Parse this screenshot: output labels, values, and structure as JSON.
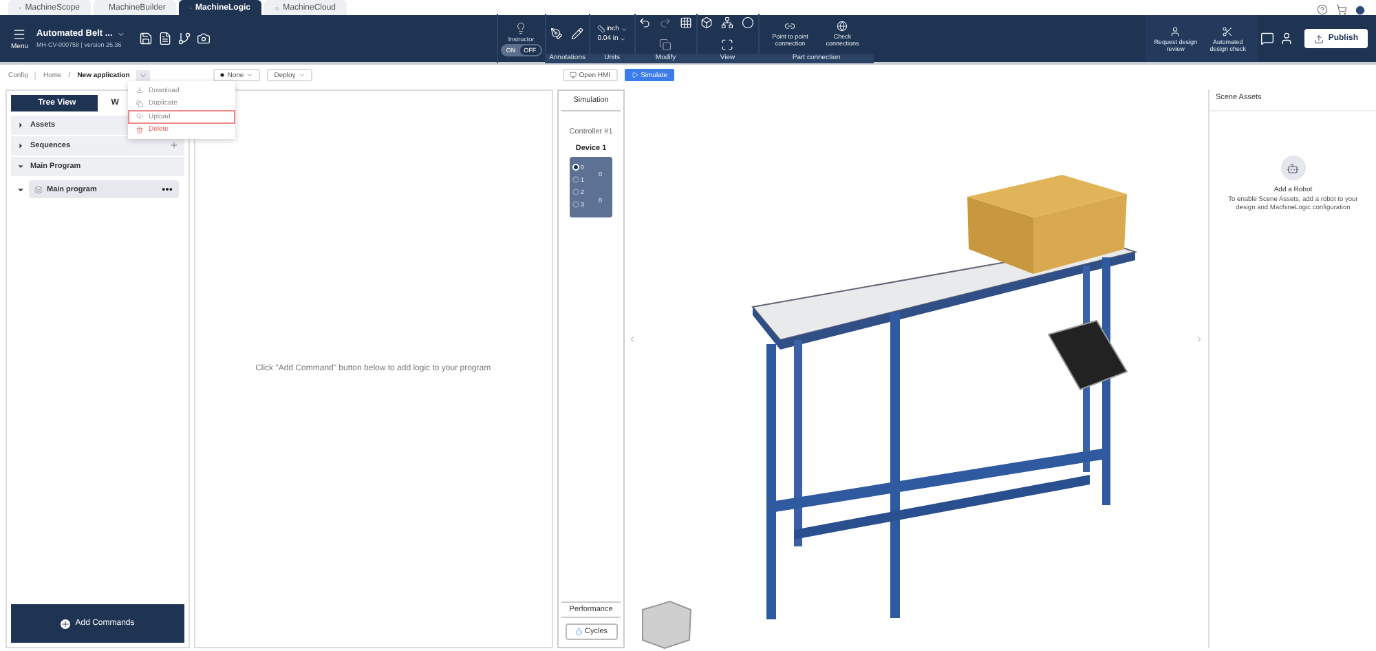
{
  "product_tabs": [
    {
      "label": "MachineScope",
      "selected": false
    },
    {
      "label": "MachineBuilder",
      "selected": false
    },
    {
      "label": "MachineLogic",
      "selected": true
    },
    {
      "label": "MachineCloud",
      "selected": false
    }
  ],
  "toolbar": {
    "menu_label": "Menu",
    "project_title": "Automated Belt ...",
    "project_subtitle": "MH-CV-000758 | version 26.36",
    "instructor": {
      "label": "Instructor",
      "on_label": "ON",
      "off_label": "OFF",
      "on": false
    },
    "units": {
      "unit": "inch",
      "precision": "0.04 in"
    },
    "groups": [
      "Annotations",
      "Units",
      "Modify",
      "View",
      "Part connection"
    ],
    "connection_buttons": [
      "Point to point connection",
      "Check connections"
    ],
    "review_buttons": [
      "Request design review",
      "Automated design check"
    ],
    "publish": "Publish"
  },
  "subbar": {
    "breadcrumb": [
      "Config",
      "Home",
      "New application"
    ],
    "breadcrumb_separator": "/",
    "controller": "None",
    "deploy": "Deploy",
    "open_hmi": "Open HMI",
    "simulate": "Simulate"
  },
  "app_menu": [
    {
      "label": "Download",
      "kind": "normal",
      "selected": false
    },
    {
      "label": "Duplicate",
      "kind": "normal",
      "selected": false
    },
    {
      "label": "Upload",
      "kind": "normal",
      "selected": true
    },
    {
      "label": "Delete",
      "kind": "danger",
      "selected": false
    }
  ],
  "left_panel": {
    "tabs": [
      {
        "label": "Tree View",
        "selected": true
      },
      {
        "label": "W",
        "selected": false
      }
    ],
    "tree": [
      {
        "label": "Assets",
        "expanded": false
      },
      {
        "label": "Sequences",
        "expanded": false,
        "addable": true
      },
      {
        "label": "Main Program",
        "expanded": true,
        "addable": false,
        "children": [
          {
            "label": "Main program",
            "expanded": true
          }
        ]
      }
    ],
    "add_commands": "Add Commands"
  },
  "program_hint": "Click \"Add Command\" button below to add logic to your program",
  "simulation": {
    "title": "Simulation",
    "controller": "Controller #1",
    "device": "Device 1",
    "inputs": [
      {
        "label": "0",
        "active": true
      },
      {
        "label": "1",
        "active": false
      },
      {
        "label": "2",
        "active": false
      },
      {
        "label": "3",
        "active": false
      }
    ],
    "outputs": [
      "0",
      "0"
    ],
    "performance": "Performance",
    "cycles": "Cycles"
  },
  "scene_assets": {
    "title": "Scene Assets",
    "heading": "Add a Robot",
    "description": "To enable Scene Assets, add a robot to your design and MachineLogic configuration"
  }
}
